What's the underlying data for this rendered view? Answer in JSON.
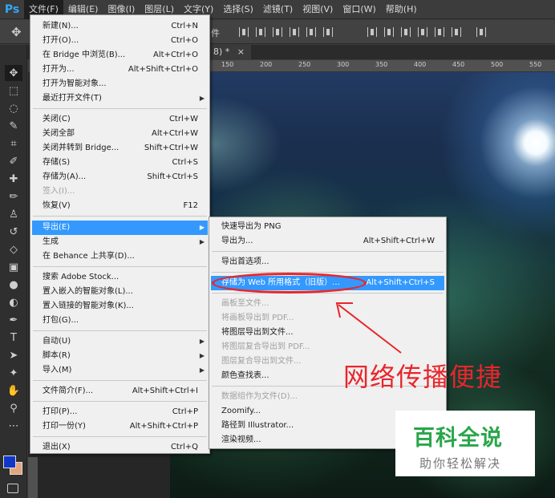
{
  "app": {
    "logo": "Ps"
  },
  "menubar": {
    "items": [
      "文件(F)",
      "编辑(E)",
      "图像(I)",
      "图层(L)",
      "文字(Y)",
      "选择(S)",
      "滤镜(T)",
      "视图(V)",
      "窗口(W)",
      "帮助(H)"
    ],
    "active_index": 0
  },
  "options_bar": {
    "label_fragment": "件"
  },
  "document_tab": {
    "title": "8) *",
    "close_glyph": "×"
  },
  "ruler": {
    "numbers": [
      "150",
      "200",
      "250",
      "300",
      "350",
      "400",
      "450",
      "500",
      "550"
    ]
  },
  "file_menu": {
    "items": [
      {
        "label": "新建(N)...",
        "shortcut": "Ctrl+N"
      },
      {
        "label": "打开(O)...",
        "shortcut": "Ctrl+O"
      },
      {
        "label": "在 Bridge 中浏览(B)...",
        "shortcut": "Alt+Ctrl+O"
      },
      {
        "label": "打开为...",
        "shortcut": "Alt+Shift+Ctrl+O"
      },
      {
        "label": "打开为智能对象...",
        "shortcut": ""
      },
      {
        "label": "最近打开文件(T)",
        "shortcut": "",
        "submenu": true
      },
      {
        "label": "关闭(C)",
        "shortcut": "Ctrl+W"
      },
      {
        "label": "关闭全部",
        "shortcut": "Alt+Ctrl+W"
      },
      {
        "label": "关闭并转到 Bridge...",
        "shortcut": "Shift+Ctrl+W"
      },
      {
        "label": "存储(S)",
        "shortcut": "Ctrl+S"
      },
      {
        "label": "存储为(A)...",
        "shortcut": "Shift+Ctrl+S"
      },
      {
        "label": "签入(I)...",
        "shortcut": "",
        "disabled": true
      },
      {
        "label": "恢复(V)",
        "shortcut": "F12"
      },
      {
        "label": "导出(E)",
        "shortcut": "",
        "submenu": true,
        "highlighted": true
      },
      {
        "label": "生成",
        "shortcut": "",
        "submenu": true
      },
      {
        "label": "在 Behance 上共享(D)...",
        "shortcut": ""
      },
      {
        "label": "搜索 Adobe Stock...",
        "shortcut": ""
      },
      {
        "label": "置入嵌入的智能对象(L)...",
        "shortcut": ""
      },
      {
        "label": "置入链接的智能对象(K)...",
        "shortcut": ""
      },
      {
        "label": "打包(G)...",
        "shortcut": ""
      },
      {
        "label": "自动(U)",
        "shortcut": "",
        "submenu": true
      },
      {
        "label": "脚本(R)",
        "shortcut": "",
        "submenu": true
      },
      {
        "label": "导入(M)",
        "shortcut": "",
        "submenu": true
      },
      {
        "label": "文件简介(F)...",
        "shortcut": "Alt+Shift+Ctrl+I"
      },
      {
        "label": "打印(P)...",
        "shortcut": "Ctrl+P"
      },
      {
        "label": "打印一份(Y)",
        "shortcut": "Alt+Shift+Ctrl+P"
      },
      {
        "label": "退出(X)",
        "shortcut": "Ctrl+Q"
      }
    ]
  },
  "export_submenu": {
    "items": [
      {
        "label": "快速导出为 PNG",
        "shortcut": ""
      },
      {
        "label": "导出为...",
        "shortcut": "Alt+Shift+Ctrl+W"
      },
      {
        "label": "导出首选项...",
        "shortcut": ""
      },
      {
        "label": "存储为 Web 所用格式（旧版）...",
        "shortcut": "Alt+Shift+Ctrl+S",
        "highlighted": true
      },
      {
        "label": "画板至文件...",
        "shortcut": "",
        "disabled": true
      },
      {
        "label": "将画板导出到 PDF...",
        "shortcut": "",
        "disabled": true
      },
      {
        "label": "将图层导出到文件...",
        "shortcut": ""
      },
      {
        "label": "将图层复合导出到 PDF...",
        "shortcut": "",
        "disabled": true
      },
      {
        "label": "图层复合导出到文件...",
        "shortcut": "",
        "disabled": true
      },
      {
        "label": "颜色查找表...",
        "shortcut": ""
      },
      {
        "label": "数据组作为文件(D)...",
        "shortcut": "",
        "disabled": true
      },
      {
        "label": "Zoomify...",
        "shortcut": ""
      },
      {
        "label": "路径到 Illustrator...",
        "shortcut": ""
      },
      {
        "label": "渲染视频...",
        "shortcut": ""
      }
    ]
  },
  "annotation": {
    "text": "网络传播便捷",
    "color": "#e8262c"
  },
  "watermark": {
    "title": "百科全说",
    "subtitle": "助你轻松解决",
    "title_color": "#29a64a"
  },
  "colors": {
    "foreground": "#1136c9",
    "background": "#e2a67d",
    "menu_highlight": "#3399ff"
  }
}
